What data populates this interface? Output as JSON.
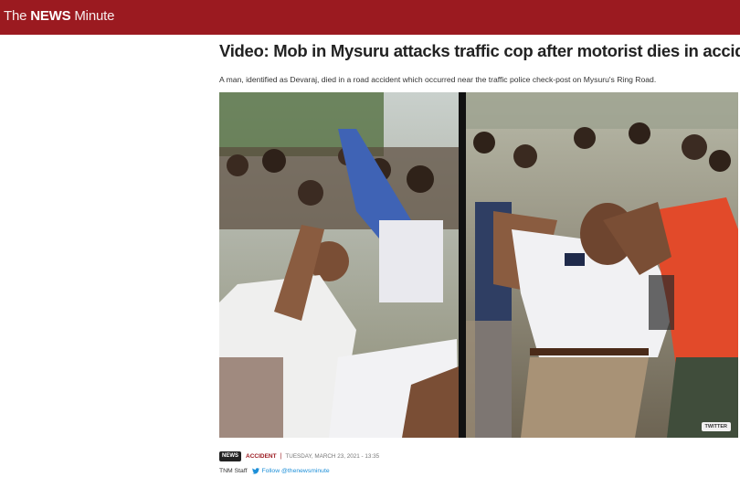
{
  "header": {
    "logo_prefix": "The ",
    "logo_bold": "NEWS",
    "logo_suffix": " Minute",
    "bar_color": "#9b1a20"
  },
  "article": {
    "headline": "Video: Mob in Mysuru attacks traffic cop after motorist dies in accident",
    "summary": "A man, identified as Devaraj, died in a road accident which occurred near the traffic police check-post on Mysuru's Ring Road.",
    "media_badge": "TWITTER",
    "section_badge": "NEWS",
    "category": "ACCIDENT",
    "separator": "|",
    "date": "TUESDAY, MARCH 23, 2021 - 13:35",
    "author": "TNM Staff",
    "follow_label": "Follow @thenewsminute",
    "follow_icon": "twitter-bird-icon"
  }
}
